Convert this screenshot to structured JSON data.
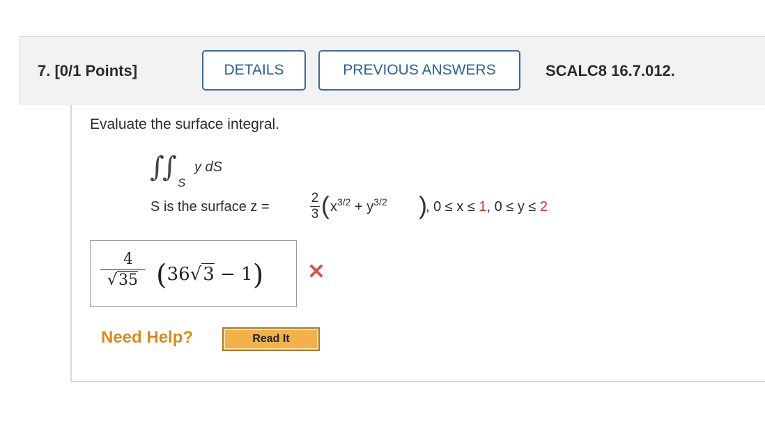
{
  "question": {
    "number_points": "7.  [0/1 Points]",
    "details_label": "DETAILS",
    "previous_answers_label": "PREVIOUS ANSWERS",
    "reference": "SCALC8 16.7.012."
  },
  "problem": {
    "prompt": "Evaluate the surface integral.",
    "integrand": "y dS",
    "subscript": "S",
    "surface_text": "S is the surface  z = ",
    "frac_num": "2",
    "frac_den": "3",
    "term1": "x",
    "exp1": "3/2",
    "plus": " + ",
    "term2": "y",
    "exp2": "3/2",
    "cond_prefix": ", 0 ≤ x ≤ ",
    "x_upper": "1",
    "cond_middle": ", 0 ≤ y ≤ ",
    "y_upper": "2"
  },
  "answer": {
    "num": "4",
    "den": "35",
    "expr_open": "(",
    "coef": "36",
    "radicand": "3",
    "minus_one": " − 1",
    "expr_close": ")",
    "status": "incorrect"
  },
  "help": {
    "need_help": "Need Help?",
    "read_it": "Read It"
  },
  "colors": {
    "button_border": "#3b6a95",
    "incorrect": "#d9534f",
    "help_text": "#d88a1e",
    "read_it_bg": "#f3b14b"
  }
}
